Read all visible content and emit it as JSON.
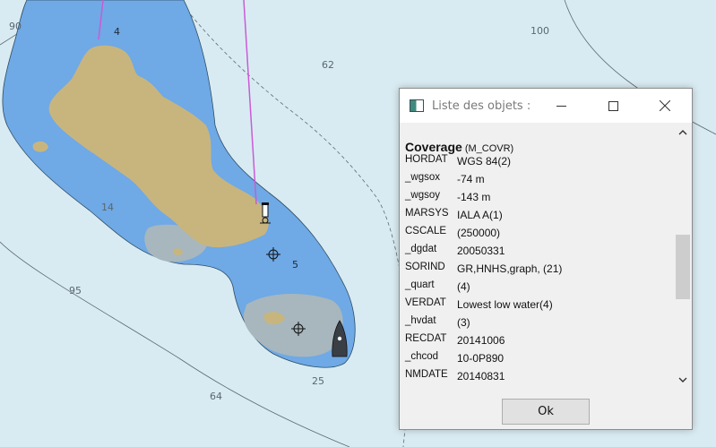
{
  "chart": {
    "depth_soundings": [
      "90",
      "4",
      "62",
      "100",
      "14",
      "5",
      "95",
      "64",
      "25"
    ],
    "colors": {
      "deep_water": "#d9ebf2",
      "shallow_water": "#6fa9e6",
      "intertidal": "#a7b7bd",
      "land": "#c8b57e",
      "route": "#c85cd6"
    },
    "symbols": [
      "lighthouse-icon",
      "wreck-icon",
      "wreck-icon",
      "buoy-icon"
    ]
  },
  "dialog": {
    "title": "Liste des objets :",
    "object_name": "Coverage",
    "object_code": "(M_COVR)",
    "attributes": [
      {
        "key": "HORDAT",
        "value": "WGS 84(2)"
      },
      {
        "key": "_wgsox",
        "value": "-74 m"
      },
      {
        "key": "_wgsoy",
        "value": "-143 m"
      },
      {
        "key": "MARSYS",
        "value": "IALA A(1)"
      },
      {
        "key": "CSCALE",
        "value": "(250000)"
      },
      {
        "key": "_dgdat",
        "value": "20050331"
      },
      {
        "key": "SORIND",
        "value": "GR,HNHS,graph, (21)"
      },
      {
        "key": "_quart",
        "value": "(4)"
      },
      {
        "key": "VERDAT",
        "value": "Lowest low water(4)"
      },
      {
        "key": "_hvdat",
        "value": "(3)"
      },
      {
        "key": "RECDAT",
        "value": "20141006"
      },
      {
        "key": "_chcod",
        "value": "10-0P890"
      },
      {
        "key": "NMDATE",
        "value": "20140831"
      }
    ],
    "ok_label": "Ok"
  }
}
